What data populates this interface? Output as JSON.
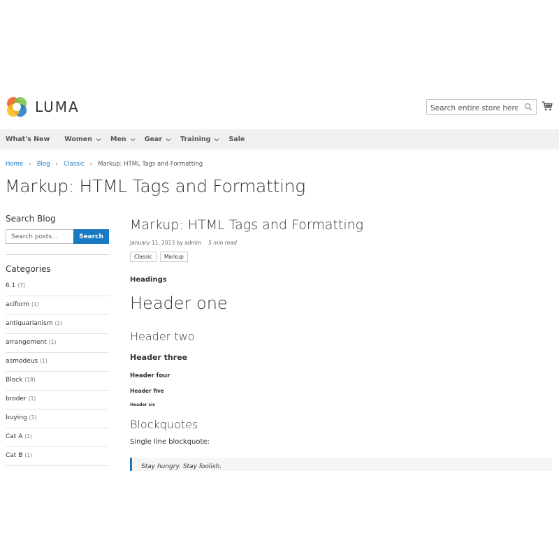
{
  "header": {
    "brand": "LUMA",
    "search_placeholder": "Search entire store here...",
    "brand_colors": [
      "#f26322",
      "#7ac143",
      "#1979c3",
      "#fdb813"
    ]
  },
  "nav": {
    "items": [
      {
        "label": "What's New",
        "has_dropdown": false
      },
      {
        "label": "Women",
        "has_dropdown": true
      },
      {
        "label": "Men",
        "has_dropdown": true
      },
      {
        "label": "Gear",
        "has_dropdown": true
      },
      {
        "label": "Training",
        "has_dropdown": true
      },
      {
        "label": "Sale",
        "has_dropdown": false
      }
    ]
  },
  "breadcrumb": {
    "items": [
      "Home",
      "Blog",
      "Classic"
    ],
    "current": "Markup: HTML Tags and Formatting",
    "separator": "›"
  },
  "page_title": "Markup: HTML Tags and Formatting",
  "sidebar": {
    "search_heading": "Search Blog",
    "search_placeholder": "Search posts...",
    "search_button": "Search",
    "categories_heading": "Categories",
    "categories": [
      {
        "name": "6.1",
        "count": "(7)"
      },
      {
        "name": "aciform",
        "count": "(1)"
      },
      {
        "name": "antiquarianism",
        "count": "(1)"
      },
      {
        "name": "arrangement",
        "count": "(1)"
      },
      {
        "name": "asmodeus",
        "count": "(1)"
      },
      {
        "name": "Block",
        "count": "(18)"
      },
      {
        "name": "broder",
        "count": "(1)"
      },
      {
        "name": "buying",
        "count": "(1)"
      },
      {
        "name": "Cat A",
        "count": "(1)"
      },
      {
        "name": "Cat B",
        "count": "(1)"
      }
    ]
  },
  "post": {
    "title": "Markup: HTML Tags and Formatting",
    "date": "January 11, 2013",
    "by_label": "by",
    "author": "admin",
    "read_time": "5 min read",
    "tags": [
      "Classic",
      "Markup"
    ],
    "headings_label": "Headings",
    "h1": "Header one",
    "h2": "Header two",
    "h3": "Header three",
    "h4": "Header four",
    "h5": "Header five",
    "h6": "Header six",
    "blockquotes_title": "Blockquotes",
    "blockquote_intro": "Single line blockquote:",
    "blockquote_text": "Stay hungry. Stay foolish."
  },
  "colors": {
    "accent": "#1979c3",
    "nav_bg": "#f0f0f0"
  }
}
